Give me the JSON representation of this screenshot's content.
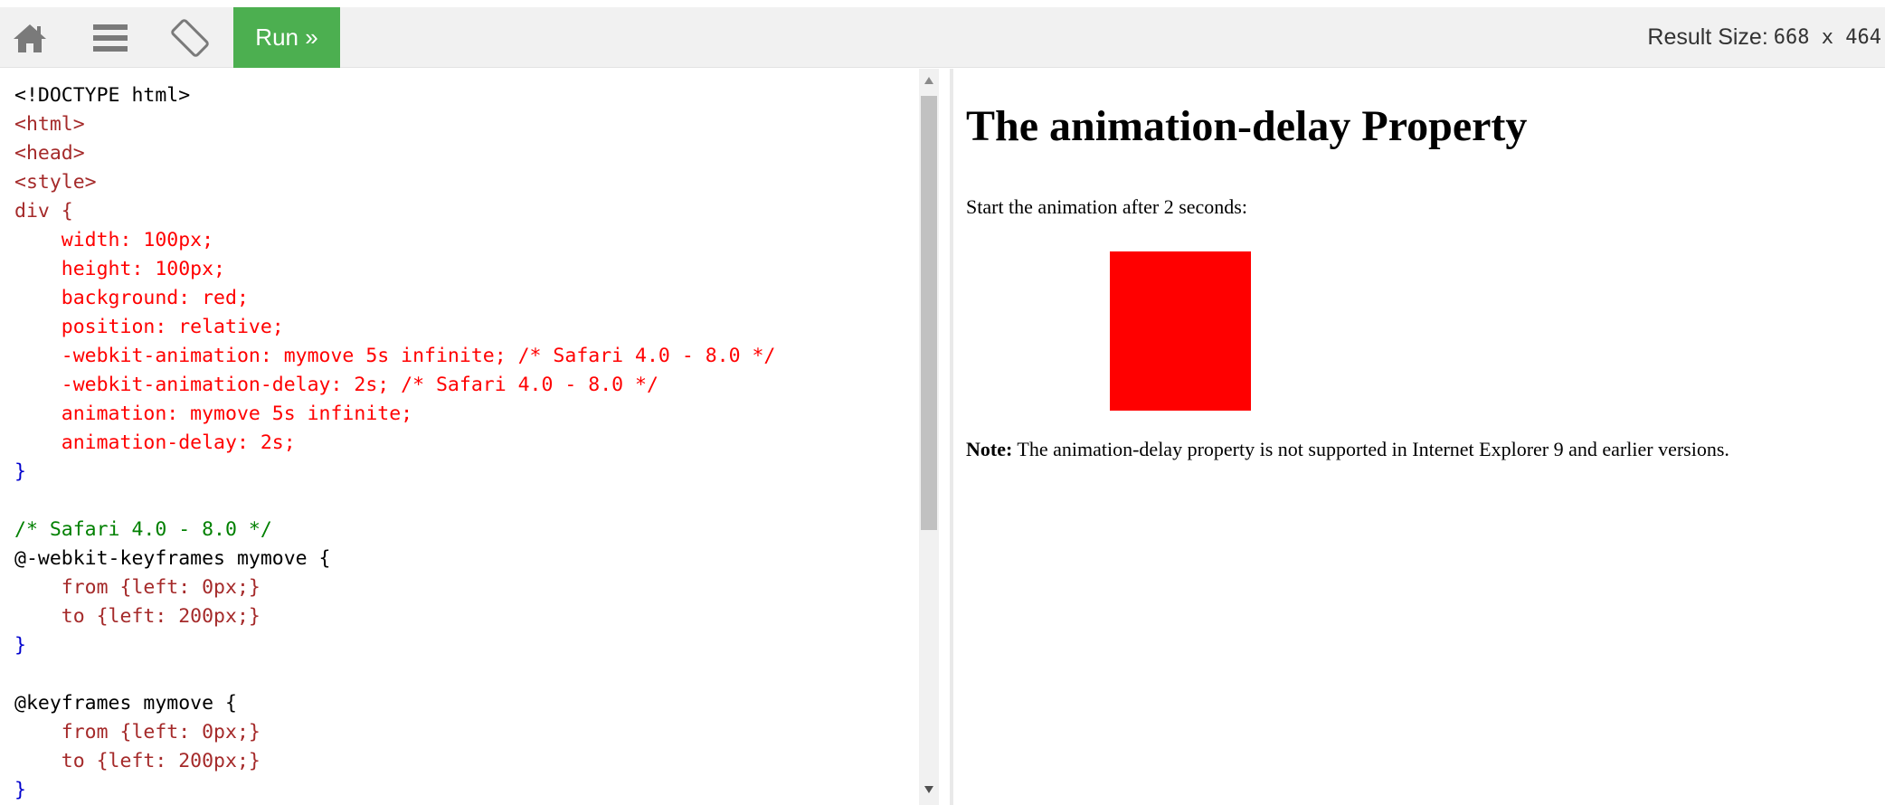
{
  "toolbar": {
    "icons": [
      "home-icon",
      "menu-icon",
      "rotate-icon"
    ],
    "run_label": "Run »",
    "result_size_label": "Result Size:",
    "result_size_value": "668 x 464",
    "colors": {
      "run_bg": "#4caf50",
      "toolbar_bg": "#f1f1f1"
    }
  },
  "editor": {
    "lines": [
      "<!DOCTYPE html>",
      "<html>",
      "<head>",
      "<style>",
      "div {",
      "    width: 100px;",
      "    height: 100px;",
      "    background: red;",
      "    position: relative;",
      "    -webkit-animation: mymove 5s infinite; /* Safari 4.0 - 8.0 */",
      "    -webkit-animation-delay: 2s; /* Safari 4.0 - 8.0 */",
      "    animation: mymove 5s infinite;",
      "    animation-delay: 2s;",
      "}",
      "",
      "/* Safari 4.0 - 8.0 */",
      "@-webkit-keyframes mymove {",
      "    from {left: 0px;}",
      "    to {left: 200px;}",
      "}",
      "",
      "@keyframes mymove {",
      "    from {left: 0px;}",
      "    to {left: 200px;}",
      "}"
    ]
  },
  "result": {
    "heading": "The animation-delay Property",
    "intro": "Start the animation after 2 seconds:",
    "note_label": "Note:",
    "note_text": " The animation-delay property is not supported in Internet Explorer 9 and earlier versions.",
    "box_color": "#ff0000"
  }
}
